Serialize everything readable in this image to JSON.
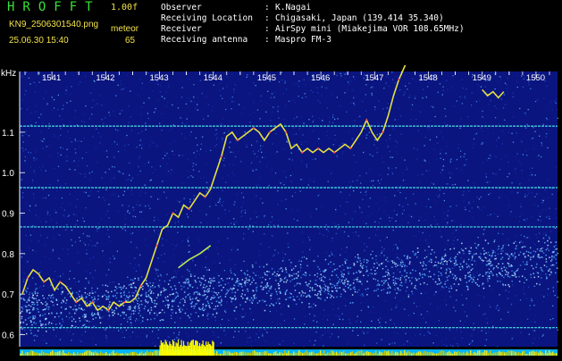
{
  "header": {
    "app_title": "HROFFT",
    "version": "1.00f",
    "file_name": "KN9_2506301540.png",
    "timestamp": "25.06.30 15:40",
    "meteor_label": "meteor",
    "meteor_count": "65",
    "info_rows": [
      {
        "label": "Observer",
        "value": "K.Nagai"
      },
      {
        "label": "Receiving Location",
        "value": "Chigasaki, Japan (139.414 35.340)"
      },
      {
        "label": "Receiver",
        "value": "AirSpy mini (Miakejima VOR 108.65MHz)"
      },
      {
        "label": "Receiving antenna",
        "value": "Maspro FM-3"
      }
    ]
  },
  "colors": {
    "background": "#000000",
    "noise_dark": "#0a1a9a",
    "noise_light": "#4aa0ff",
    "reference_line": "#46e0e0",
    "trace": "#e4e040",
    "trace_dot": "#ff4a4a",
    "activity_bar": "#ffff00",
    "baseline": "#00b4ff"
  },
  "chart_data": {
    "type": "line",
    "title": "",
    "xlabel": "",
    "ylabel": "kHz",
    "x_tick_labels": [
      "1541",
      "1542",
      "1543",
      "1544",
      "1545",
      "1546",
      "1547",
      "1548",
      "1549",
      "1550"
    ],
    "y_tick_labels": [
      "1.1",
      "1.0",
      "0.9",
      "0.8",
      "0.7",
      "0.6"
    ],
    "ylim": [
      0.57,
      1.25
    ],
    "xlim": [
      1540.4,
      1550.4
    ],
    "reference_lines_khz": [
      1.115,
      0.963,
      0.866,
      0.617
    ],
    "series": [
      {
        "x": [
          1540.45,
          1540.55,
          1540.65,
          1540.75,
          1540.85,
          1540.95,
          1541.05,
          1541.15,
          1541.25,
          1541.35,
          1541.45,
          1541.55,
          1541.65,
          1541.75,
          1541.85,
          1541.95,
          1542.05,
          1542.15,
          1542.25,
          1542.35,
          1542.45,
          1542.55,
          1542.65,
          1542.75,
          1542.85,
          1542.95,
          1543.05,
          1543.15,
          1543.25,
          1543.35,
          1543.45,
          1543.55,
          1543.65,
          1543.75,
          1543.85,
          1543.95,
          1544.05,
          1544.15,
          1544.25,
          1544.35,
          1544.45,
          1544.55,
          1544.65,
          1544.75,
          1544.85,
          1544.95,
          1545.05,
          1545.15,
          1545.25,
          1545.35,
          1545.45,
          1545.55,
          1545.65,
          1545.75,
          1545.85,
          1545.95,
          1546.05,
          1546.15,
          1546.25,
          1546.35,
          1546.45,
          1546.55,
          1546.65,
          1546.75,
          1546.85,
          1546.95,
          1547.05,
          1547.15,
          1547.25,
          1547.35,
          1547.45,
          1547.55,
          1547.65,
          1547.75
        ],
        "y": [
          0.7,
          0.74,
          0.76,
          0.75,
          0.73,
          0.74,
          0.71,
          0.73,
          0.72,
          0.7,
          0.68,
          0.69,
          0.67,
          0.68,
          0.66,
          0.67,
          0.66,
          0.68,
          0.67,
          0.68,
          0.68,
          0.69,
          0.72,
          0.74,
          0.78,
          0.82,
          0.86,
          0.87,
          0.9,
          0.89,
          0.92,
          0.91,
          0.93,
          0.95,
          0.94,
          0.96,
          1.0,
          1.04,
          1.09,
          1.1,
          1.08,
          1.09,
          1.1,
          1.11,
          1.1,
          1.08,
          1.1,
          1.11,
          1.12,
          1.1,
          1.06,
          1.07,
          1.05,
          1.06,
          1.05,
          1.06,
          1.05,
          1.06,
          1.05,
          1.06,
          1.07,
          1.06,
          1.08,
          1.1,
          1.13,
          1.1,
          1.08,
          1.1,
          1.14,
          1.19,
          1.23,
          1.26,
          1.29,
          1.31
        ]
      },
      {
        "x": [
          1543.35,
          1543.55,
          1543.75,
          1543.95
        ],
        "y": [
          0.765,
          0.785,
          0.8,
          0.82
        ]
      },
      {
        "x": [
          1549.0,
          1549.1,
          1549.2,
          1549.3,
          1549.4
        ],
        "y": [
          1.205,
          1.19,
          1.2,
          1.185,
          1.2
        ]
      }
    ],
    "grid": false
  }
}
